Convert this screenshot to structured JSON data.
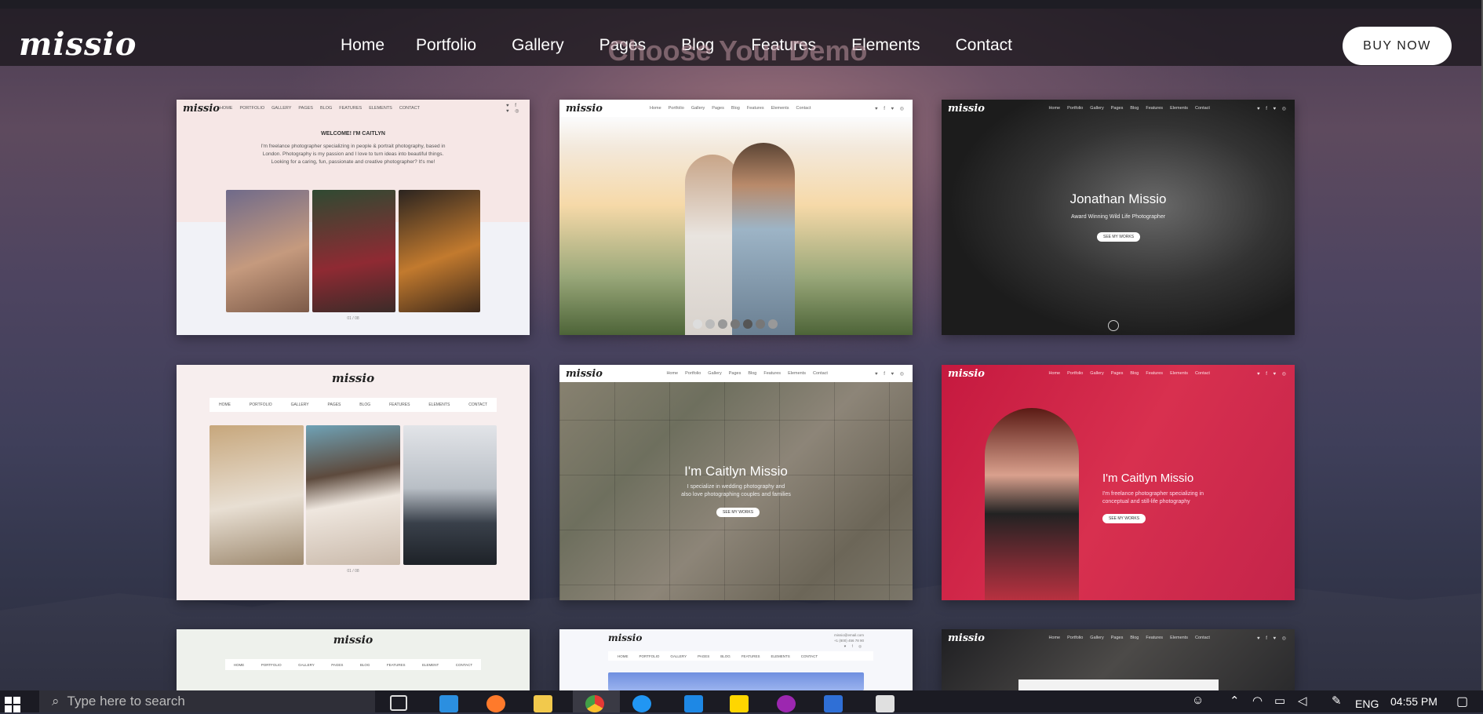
{
  "site": {
    "logo": "missio",
    "nav": [
      "Home",
      "Portfolio",
      "Gallery",
      "Pages",
      "Blog",
      "Features",
      "Elements",
      "Contact"
    ],
    "buy_label": "BUY NOW",
    "heading": "Choose Your Demo"
  },
  "demos": {
    "d1": {
      "logo": "missio",
      "nav": [
        "HOME",
        "PORTFOLIO",
        "GALLERY",
        "PAGES",
        "BLOG",
        "FEATURES",
        "ELEMENTS",
        "CONTACT"
      ],
      "welcome": "WELCOME! I'M CAITLYN",
      "intro1": "I'm freelance photographer specializing in people & portrait photography, based in",
      "intro2": "London. Photography is my passion and I love to turn ideas into beautiful things.",
      "intro3": "Looking for a caring, fun, passionate and creative photographer? It's me!",
      "counter": "01 / 08"
    },
    "d2": {
      "logo": "missio",
      "nav": [
        "Home",
        "Portfolio",
        "Gallery",
        "Pages",
        "Blog",
        "Features",
        "Elements",
        "Contact"
      ]
    },
    "d3": {
      "logo": "missio",
      "nav": [
        "Home",
        "Portfolio",
        "Gallery",
        "Pages",
        "Blog",
        "Features",
        "Elements",
        "Contact"
      ],
      "title": "Jonathan Missio",
      "subtitle": "Award Winning Wild Life Photographer",
      "button": "SEE MY WORKS"
    },
    "d4": {
      "logo": "missio",
      "nav": [
        "HOME",
        "PORTFOLIO",
        "GALLERY",
        "PAGES",
        "BLOG",
        "FEATURES",
        "ELEMENTS",
        "CONTACT"
      ],
      "counter": "01 / 08"
    },
    "d5": {
      "logo": "missio",
      "nav": [
        "Home",
        "Portfolio",
        "Gallery",
        "Pages",
        "Blog",
        "Features",
        "Elements",
        "Contact"
      ],
      "title": "I'm Caitlyn Missio",
      "sub1": "I specialize in wedding photography and",
      "sub2": "also love photographing couples and families",
      "button": "SEE MY WORKS"
    },
    "d6": {
      "logo": "missio",
      "nav": [
        "Home",
        "Portfolio",
        "Gallery",
        "Pages",
        "Blog",
        "Features",
        "Elements",
        "Contact"
      ],
      "title": "I'm Caitlyn Missio",
      "sub1": "I'm freelance photographer specializing in",
      "sub2": "conceptual and still-life photography",
      "button": "SEE MY WORKS"
    },
    "d7": {
      "logo": "missio",
      "nav": [
        "HOME",
        "PORTFOLIO",
        "GALLERY",
        "PAGES",
        "BLOG",
        "FEATURES",
        "ELEMENT",
        "CONTACT"
      ]
    },
    "d8": {
      "logo": "missio",
      "nav": [
        "HOME",
        "PORTFOLIO",
        "GALLERY",
        "PAGES",
        "BLOG",
        "FEATURES",
        "ELEMENTS",
        "CONTACT"
      ],
      "email": "missio@email.com",
      "phone": "+1 (800) 456 78 90"
    },
    "d9": {
      "logo": "missio",
      "nav": [
        "Home",
        "Portfolio",
        "Gallery",
        "Pages",
        "Blog",
        "Features",
        "Elements",
        "Contact"
      ]
    }
  },
  "taskbar": {
    "search_placeholder": "Type here to search",
    "lang": "ENG",
    "time": "04:55 PM"
  }
}
